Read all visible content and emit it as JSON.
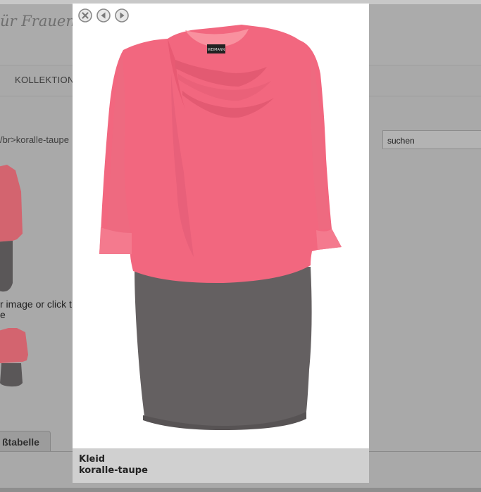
{
  "header": {
    "brand_fragment": "ür Frauen m"
  },
  "nav": {
    "items": [
      {
        "label": "KOLLEKTION"
      }
    ]
  },
  "breadcrumb": {
    "text": "/br>koralle-taupe"
  },
  "search": {
    "value": "suchen"
  },
  "product_page": {
    "hint_line1": "r image or click t",
    "hint_line2": "e",
    "tab_label": "ßtabelle"
  },
  "lightbox": {
    "caption_title": "Kleid",
    "caption_subtitle": "koralle-taupe",
    "buttons": [
      {
        "icon": "close-icon"
      },
      {
        "icon": "previous-icon"
      },
      {
        "icon": "next-icon"
      }
    ],
    "label_tag": "WEIMANN"
  },
  "colors": {
    "overlay": "#a9a9a9",
    "top_color": "#f2677f",
    "skirt_color": "#646061",
    "caption_bg": "#d0d0d0"
  }
}
